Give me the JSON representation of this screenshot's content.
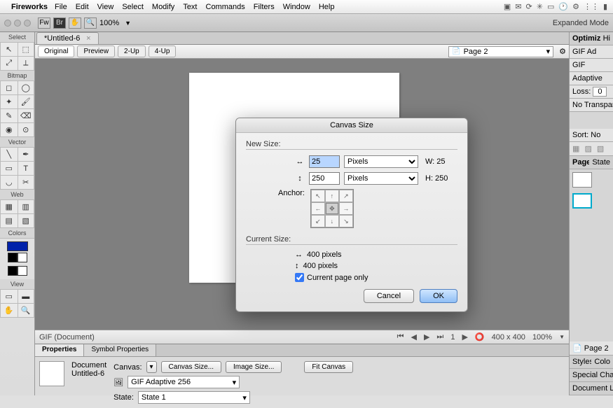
{
  "menubar": {
    "app": "Fireworks",
    "items": [
      "File",
      "Edit",
      "View",
      "Select",
      "Modify",
      "Text",
      "Commands",
      "Filters",
      "Window",
      "Help"
    ]
  },
  "app_bar": {
    "label_fw": "Fw",
    "label_br": "Br",
    "zoom": "100%",
    "right": "Expanded Mode"
  },
  "document": {
    "tab": "*Untitled-6",
    "views": {
      "original": "Original",
      "preview": "Preview",
      "two_up": "2-Up",
      "four_up": "4-Up"
    },
    "page_selector": "Page 2"
  },
  "status": {
    "left": "GIF (Document)",
    "dims": "400 x 400",
    "zoom": "100%"
  },
  "props": {
    "tabs": {
      "properties": "Properties",
      "symbol": "Symbol Properties"
    },
    "doc_label": "Document",
    "doc_name": "Untitled-6",
    "canvas_label": "Canvas:",
    "canvas_size_btn": "Canvas Size...",
    "image_size_btn": "Image Size...",
    "fit_canvas_btn": "Fit Canvas",
    "gif_mode": "GIF Adaptive 256",
    "state_label": "State:",
    "state_value": "State 1"
  },
  "right": {
    "optimize": "Optimize",
    "hi": "Hi",
    "gif_ad": "GIF Ad",
    "gif": "GIF",
    "adaptive": "Adaptive",
    "loss": "Loss:",
    "loss_val": "0",
    "no_transparency": "No Transpar",
    "sort": "Sort:",
    "sort_val": "No",
    "pages": "Pages",
    "states": "State",
    "styles": "Styles",
    "color": "Colo",
    "special": "Special Chara",
    "doclib": "Document Lib",
    "page2": "Page 2"
  },
  "tools": {
    "select": "Select",
    "bitmap": "Bitmap",
    "vector": "Vector",
    "web": "Web",
    "colors": "Colors",
    "view": "View"
  },
  "dialog": {
    "title": "Canvas Size",
    "new_size": "New Size:",
    "width_val": "25",
    "height_val": "250",
    "unit": "Pixels",
    "w_suffix": "W: 25",
    "h_suffix": "H: 250",
    "anchor": "Anchor:",
    "current_size": "Current Size:",
    "cur_w": "400 pixels",
    "cur_h": "400 pixels",
    "page_only": "Current page only",
    "cancel": "Cancel",
    "ok": "OK"
  },
  "chart_data": null
}
